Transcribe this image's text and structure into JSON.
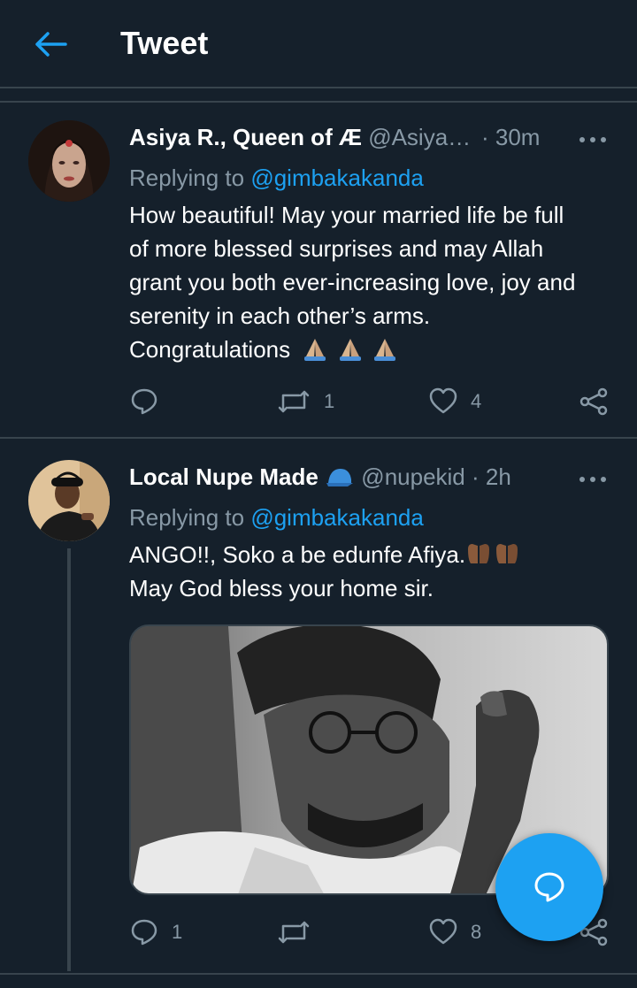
{
  "header": {
    "title": "Tweet"
  },
  "tweets": [
    {
      "display_name": "Asiya R., Queen of Æ",
      "handle": "@Asiya…",
      "time": "· 30m",
      "replying_prefix": "Replying to",
      "replying_to": "@gimbakakanda",
      "lines": [
        "How beautiful! May your married life be full",
        "of more blessed surprises and may Allah",
        "grant you both ever-increasing love, joy and",
        "serenity in each other’s arms.",
        "Congratulations"
      ],
      "emojis": [
        "folded-hands",
        "folded-hands",
        "folded-hands"
      ],
      "stats": {
        "replies": "",
        "retweets": "1",
        "likes": "4"
      }
    },
    {
      "display_name": "Local Nupe Made",
      "name_emoji": "billed-cap",
      "handle": "@nupekid",
      "time": "· 2h",
      "replying_prefix": "Replying to",
      "replying_to": "@gimbakakanda",
      "lines": [
        "ANGO!!, Soko a be edunfe Afiya.",
        "May God bless your home sir."
      ],
      "emojis": [
        "open-hands",
        "open-hands"
      ],
      "stats": {
        "replies": "1",
        "retweets": "",
        "likes": "8"
      }
    }
  ],
  "colors": {
    "background": "#15202b",
    "accent": "#1da1f2",
    "muted": "#8899a6",
    "divider": "#38444d"
  },
  "icons": [
    "arrow-left-icon",
    "more-icon",
    "reply-icon",
    "retweet-icon",
    "like-icon",
    "share-icon",
    "compose-reply-icon"
  ]
}
